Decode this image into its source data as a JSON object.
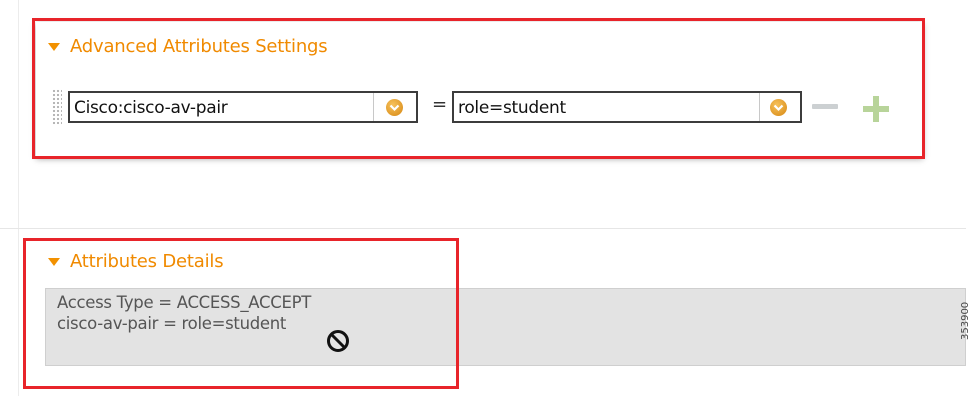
{
  "advanced_attributes": {
    "title": "Advanced Attributes Settings",
    "dictionary_value": "Cisco:cisco-av-pair",
    "equals_sign": "=",
    "attribute_value": "role=student"
  },
  "attribute_details": {
    "title": "Attributes Details",
    "lines": [
      "Access Type = ACCESS_ACCEPT",
      "cisco-av-pair = role=student"
    ]
  },
  "side_code": "353900",
  "colors": {
    "section_title": "#f08a00",
    "highlight_border": "#e8242a",
    "dropdown_button": "#e09a2a",
    "add_icon": "#b8d49a",
    "remove_icon": "#ccd0d2"
  },
  "icons": {
    "section_toggle": "triangle-down-icon",
    "dropdown": "chevron-down-icon",
    "remove": "minus-icon",
    "add": "plus-icon",
    "status": "forbidden-icon"
  }
}
